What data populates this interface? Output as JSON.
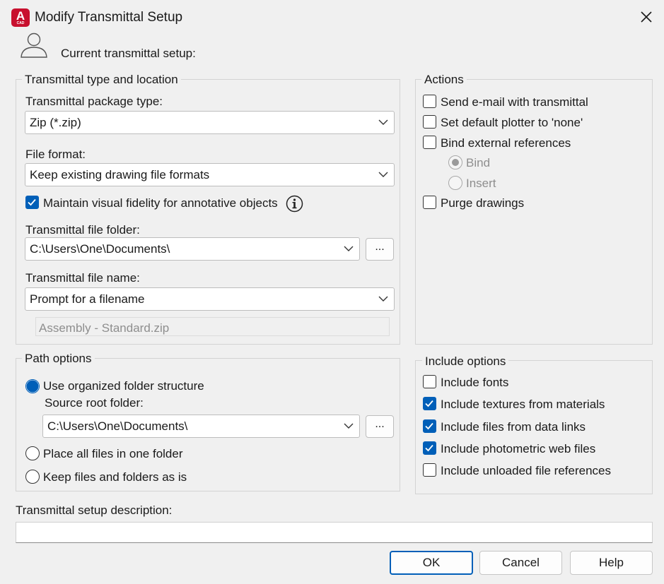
{
  "window": {
    "title": "Modify Transmittal Setup",
    "app_icon_letter": "A",
    "app_icon_sub": "CAD",
    "accent_color": "#005fb8",
    "app_icon_color": "#c8102e"
  },
  "header": {
    "current_setup_label": "Current transmittal setup:"
  },
  "type_location": {
    "group_label": "Transmittal type and location",
    "package_type_label": "Transmittal package type:",
    "package_type_value": "Zip (*.zip)",
    "file_format_label": "File format:",
    "file_format_value": "Keep existing drawing file formats",
    "maintain_fidelity_label": "Maintain visual fidelity for annotative objects",
    "maintain_fidelity_checked": true,
    "folder_label": "Transmittal file folder:",
    "folder_value": "C:\\Users\\One\\Documents\\",
    "browse_label": "...",
    "file_name_label": "Transmittal file name:",
    "file_name_value": "Prompt for a filename",
    "file_name_preview": "Assembly - Standard.zip"
  },
  "path_options": {
    "group_label": "Path options",
    "organized_label": "Use organized folder structure",
    "organized_selected": true,
    "source_root_label": "Source root folder:",
    "source_root_value": "C:\\Users\\One\\Documents\\",
    "browse_label": "...",
    "one_folder_label": "Place all files in one folder",
    "keep_as_is_label": "Keep files and folders as is"
  },
  "actions": {
    "group_label": "Actions",
    "send_email_label": "Send e-mail with transmittal",
    "default_plotter_label": "Set default plotter to 'none'",
    "bind_xrefs_label": "Bind external references",
    "bind_label": "Bind",
    "insert_label": "Insert",
    "purge_label": "Purge drawings"
  },
  "include_options": {
    "group_label": "Include options",
    "fonts_label": "Include fonts",
    "fonts_checked": false,
    "textures_label": "Include textures from materials",
    "textures_checked": true,
    "data_links_label": "Include files from data links",
    "data_links_checked": true,
    "photometric_label": "Include photometric web files",
    "photometric_checked": true,
    "unloaded_label": "Include unloaded file references",
    "unloaded_checked": false
  },
  "description": {
    "label": "Transmittal setup description:",
    "value": ""
  },
  "buttons": {
    "ok": "OK",
    "cancel": "Cancel",
    "help": "Help"
  }
}
